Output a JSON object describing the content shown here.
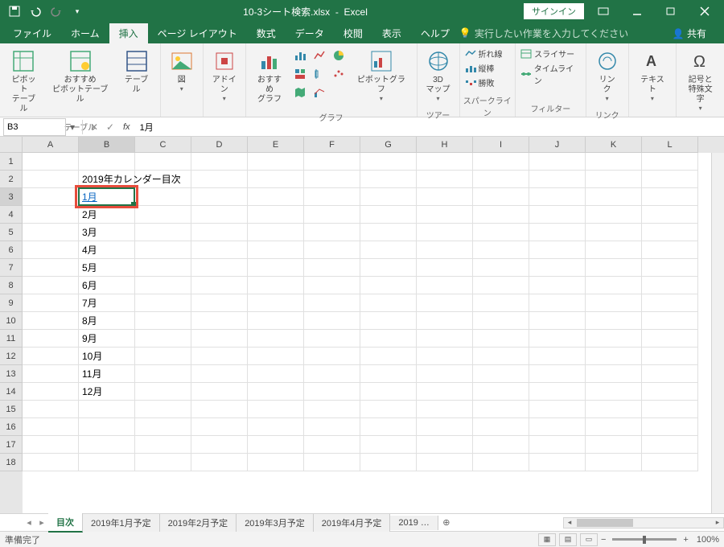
{
  "title": {
    "filename": "10-3シート検索.xlsx",
    "app": "Excel"
  },
  "signin": "サインイン",
  "menu": {
    "file": "ファイル",
    "home": "ホーム",
    "insert": "挿入",
    "pagelayout": "ページ レイアウト",
    "formulas": "数式",
    "data": "データ",
    "review": "校閲",
    "view": "表示",
    "help": "ヘルプ",
    "tellme": "実行したい作業を入力してください",
    "share": "共有"
  },
  "ribbon": {
    "tables": {
      "pivot": "ピボット\nテーブル",
      "recpivot": "おすすめ\nピボットテーブル",
      "table": "テーブル",
      "group": "テーブル"
    },
    "illust": {
      "pictures": "図",
      "addins": "アドイ\nン"
    },
    "charts": {
      "rec": "おすすめ\nグラフ",
      "pivotchart": "ピボットグラフ",
      "group": "グラフ"
    },
    "tours": {
      "map3d": "3D\nマップ",
      "group": "ツアー"
    },
    "sparklines": {
      "line": "折れ線",
      "column": "縦棒",
      "winloss": "勝敗",
      "group": "スパークライン"
    },
    "filters": {
      "slicer": "スライサー",
      "timeline": "タイムライン",
      "group": "フィルター"
    },
    "links": {
      "link": "リン\nク",
      "group": "リンク"
    },
    "text": {
      "text": "テキスト"
    },
    "symbols": {
      "symbol": "記号と\n特殊文字"
    }
  },
  "namebox": "B3",
  "formula": "1月",
  "columns": [
    "A",
    "B",
    "C",
    "D",
    "E",
    "F",
    "G",
    "H",
    "I",
    "J",
    "K",
    "L"
  ],
  "rows": [
    "1",
    "2",
    "3",
    "4",
    "5",
    "6",
    "7",
    "8",
    "9",
    "10",
    "11",
    "12",
    "13",
    "14",
    "15",
    "16",
    "17",
    "18"
  ],
  "cells": {
    "b2": "2019年カレンダー目次",
    "b3": "1月",
    "b4": "2月",
    "b5": "3月",
    "b6": "4月",
    "b7": "5月",
    "b8": "6月",
    "b9": "7月",
    "b10": "8月",
    "b11": "9月",
    "b12": "10月",
    "b13": "11月",
    "b14": "12月"
  },
  "tabs": {
    "active": "目次",
    "others": [
      "2019年1月予定",
      "2019年2月予定",
      "2019年3月予定",
      "2019年4月予定",
      "2019 …"
    ]
  },
  "status": {
    "ready": "準備完了",
    "zoom": "100%"
  }
}
